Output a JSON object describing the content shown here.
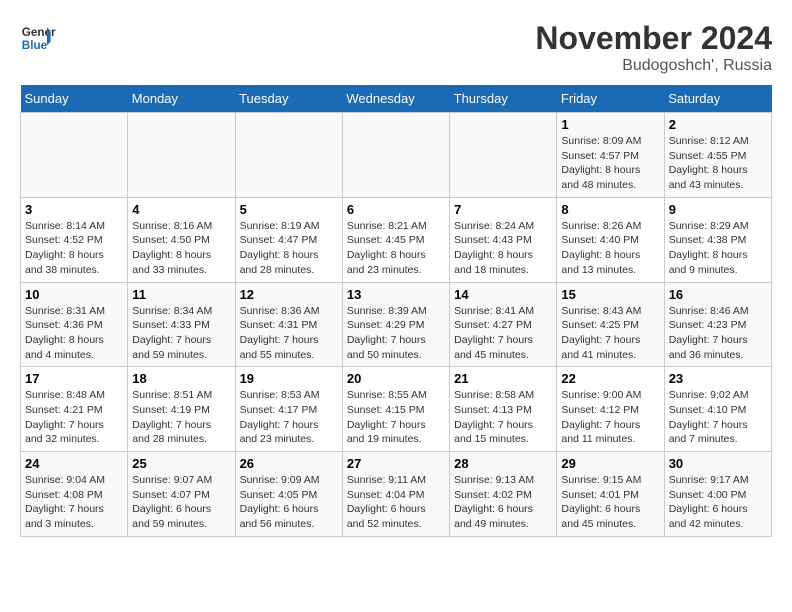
{
  "logo": {
    "line1": "General",
    "line2": "Blue"
  },
  "title": "November 2024",
  "subtitle": "Budogoshch', Russia",
  "days_of_week": [
    "Sunday",
    "Monday",
    "Tuesday",
    "Wednesday",
    "Thursday",
    "Friday",
    "Saturday"
  ],
  "weeks": [
    [
      {
        "day": "",
        "info": ""
      },
      {
        "day": "",
        "info": ""
      },
      {
        "day": "",
        "info": ""
      },
      {
        "day": "",
        "info": ""
      },
      {
        "day": "",
        "info": ""
      },
      {
        "day": "1",
        "info": "Sunrise: 8:09 AM\nSunset: 4:57 PM\nDaylight: 8 hours and 48 minutes."
      },
      {
        "day": "2",
        "info": "Sunrise: 8:12 AM\nSunset: 4:55 PM\nDaylight: 8 hours and 43 minutes."
      }
    ],
    [
      {
        "day": "3",
        "info": "Sunrise: 8:14 AM\nSunset: 4:52 PM\nDaylight: 8 hours and 38 minutes."
      },
      {
        "day": "4",
        "info": "Sunrise: 8:16 AM\nSunset: 4:50 PM\nDaylight: 8 hours and 33 minutes."
      },
      {
        "day": "5",
        "info": "Sunrise: 8:19 AM\nSunset: 4:47 PM\nDaylight: 8 hours and 28 minutes."
      },
      {
        "day": "6",
        "info": "Sunrise: 8:21 AM\nSunset: 4:45 PM\nDaylight: 8 hours and 23 minutes."
      },
      {
        "day": "7",
        "info": "Sunrise: 8:24 AM\nSunset: 4:43 PM\nDaylight: 8 hours and 18 minutes."
      },
      {
        "day": "8",
        "info": "Sunrise: 8:26 AM\nSunset: 4:40 PM\nDaylight: 8 hours and 13 minutes."
      },
      {
        "day": "9",
        "info": "Sunrise: 8:29 AM\nSunset: 4:38 PM\nDaylight: 8 hours and 9 minutes."
      }
    ],
    [
      {
        "day": "10",
        "info": "Sunrise: 8:31 AM\nSunset: 4:36 PM\nDaylight: 8 hours and 4 minutes."
      },
      {
        "day": "11",
        "info": "Sunrise: 8:34 AM\nSunset: 4:33 PM\nDaylight: 7 hours and 59 minutes."
      },
      {
        "day": "12",
        "info": "Sunrise: 8:36 AM\nSunset: 4:31 PM\nDaylight: 7 hours and 55 minutes."
      },
      {
        "day": "13",
        "info": "Sunrise: 8:39 AM\nSunset: 4:29 PM\nDaylight: 7 hours and 50 minutes."
      },
      {
        "day": "14",
        "info": "Sunrise: 8:41 AM\nSunset: 4:27 PM\nDaylight: 7 hours and 45 minutes."
      },
      {
        "day": "15",
        "info": "Sunrise: 8:43 AM\nSunset: 4:25 PM\nDaylight: 7 hours and 41 minutes."
      },
      {
        "day": "16",
        "info": "Sunrise: 8:46 AM\nSunset: 4:23 PM\nDaylight: 7 hours and 36 minutes."
      }
    ],
    [
      {
        "day": "17",
        "info": "Sunrise: 8:48 AM\nSunset: 4:21 PM\nDaylight: 7 hours and 32 minutes."
      },
      {
        "day": "18",
        "info": "Sunrise: 8:51 AM\nSunset: 4:19 PM\nDaylight: 7 hours and 28 minutes."
      },
      {
        "day": "19",
        "info": "Sunrise: 8:53 AM\nSunset: 4:17 PM\nDaylight: 7 hours and 23 minutes."
      },
      {
        "day": "20",
        "info": "Sunrise: 8:55 AM\nSunset: 4:15 PM\nDaylight: 7 hours and 19 minutes."
      },
      {
        "day": "21",
        "info": "Sunrise: 8:58 AM\nSunset: 4:13 PM\nDaylight: 7 hours and 15 minutes."
      },
      {
        "day": "22",
        "info": "Sunrise: 9:00 AM\nSunset: 4:12 PM\nDaylight: 7 hours and 11 minutes."
      },
      {
        "day": "23",
        "info": "Sunrise: 9:02 AM\nSunset: 4:10 PM\nDaylight: 7 hours and 7 minutes."
      }
    ],
    [
      {
        "day": "24",
        "info": "Sunrise: 9:04 AM\nSunset: 4:08 PM\nDaylight: 7 hours and 3 minutes."
      },
      {
        "day": "25",
        "info": "Sunrise: 9:07 AM\nSunset: 4:07 PM\nDaylight: 6 hours and 59 minutes."
      },
      {
        "day": "26",
        "info": "Sunrise: 9:09 AM\nSunset: 4:05 PM\nDaylight: 6 hours and 56 minutes."
      },
      {
        "day": "27",
        "info": "Sunrise: 9:11 AM\nSunset: 4:04 PM\nDaylight: 6 hours and 52 minutes."
      },
      {
        "day": "28",
        "info": "Sunrise: 9:13 AM\nSunset: 4:02 PM\nDaylight: 6 hours and 49 minutes."
      },
      {
        "day": "29",
        "info": "Sunrise: 9:15 AM\nSunset: 4:01 PM\nDaylight: 6 hours and 45 minutes."
      },
      {
        "day": "30",
        "info": "Sunrise: 9:17 AM\nSunset: 4:00 PM\nDaylight: 6 hours and 42 minutes."
      }
    ]
  ]
}
